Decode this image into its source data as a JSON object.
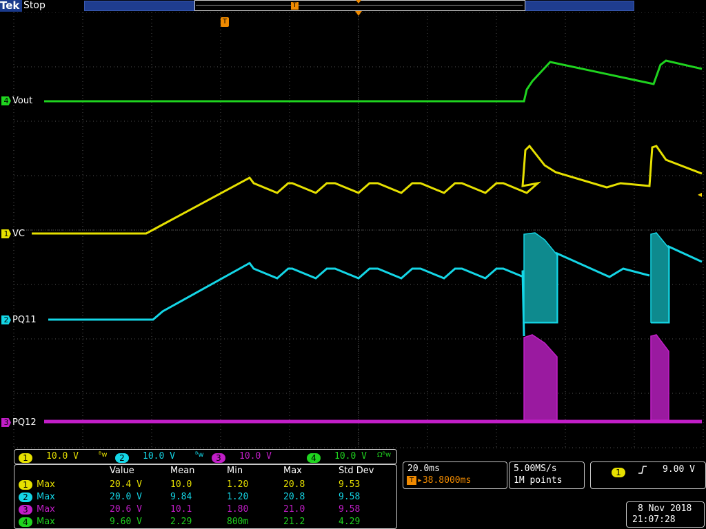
{
  "header": {
    "brand": "Tek",
    "run_state": "Stop"
  },
  "trigger_marker": "T",
  "channels": [
    {
      "num": "1",
      "name": "VC",
      "color": "#e6e000",
      "scale": "10.0 V",
      "suffix": "ᴮw"
    },
    {
      "num": "2",
      "name": "PQ11",
      "color": "#14d6e6",
      "scale": "10.0 V",
      "suffix": "ᴮw"
    },
    {
      "num": "3",
      "name": "PQ12",
      "color": "#c21ec8",
      "scale": "10.0 V",
      "suffix": ""
    },
    {
      "num": "4",
      "name": "Vout",
      "color": "#1fd41f",
      "scale": "10.0 V",
      "suffix": "Ωᴮw"
    }
  ],
  "measurements": {
    "headers": [
      "Value",
      "Mean",
      "Min",
      "Max",
      "Std Dev"
    ],
    "rows": [
      {
        "ch": "1",
        "type": "Max",
        "color": "#e6e000",
        "value": "20.4 V",
        "mean": "10.0",
        "min": "1.20",
        "max": "20.8",
        "std": "9.53"
      },
      {
        "ch": "2",
        "type": "Max",
        "color": "#14d6e6",
        "value": "20.0 V",
        "mean": "9.84",
        "min": "1.20",
        "max": "20.8",
        "std": "9.58"
      },
      {
        "ch": "3",
        "type": "Max",
        "color": "#c21ec8",
        "value": "20.6 V",
        "mean": "10.1",
        "min": "1.80",
        "max": "21.0",
        "std": "9.58"
      },
      {
        "ch": "4",
        "type": "Max",
        "color": "#1fd41f",
        "value": "9.60 V",
        "mean": "2.29",
        "min": "800m",
        "max": "21.2",
        "std": "4.29"
      }
    ]
  },
  "timebase": {
    "scale": "20.0ms",
    "position": "▸38.8000ms"
  },
  "acquisition": {
    "rate": "5.00MS/s",
    "length": "1M points"
  },
  "trigger": {
    "source": "1",
    "slope": "rising-edge-icon",
    "level": "9.00 V"
  },
  "datetime": {
    "date": "8 Nov 2018",
    "time": "21:07:28"
  },
  "colors": {
    "orange": "#f08a00",
    "grid": "#5a5a5a",
    "blue": "#1f3d8f"
  }
}
